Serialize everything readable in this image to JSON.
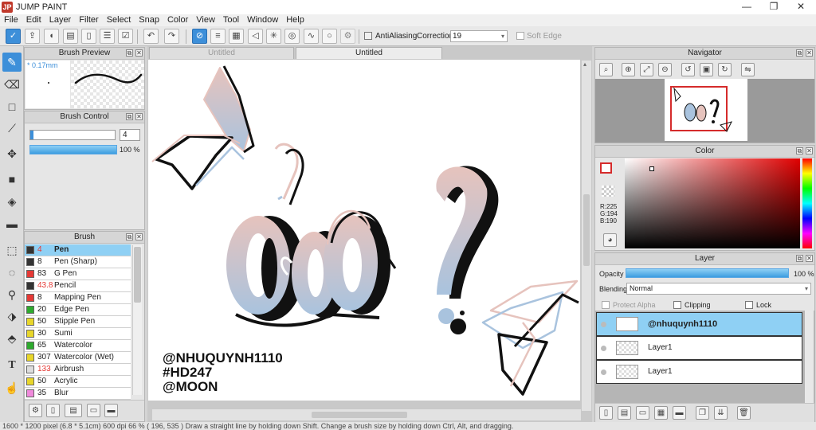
{
  "app": {
    "title": "JUMP PAINT",
    "logo": "JP"
  },
  "window_controls": {
    "minimize": "—",
    "maximize": "❐",
    "close": "✕"
  },
  "menu": [
    "File",
    "Edit",
    "Layer",
    "Filter",
    "Select",
    "Snap",
    "Color",
    "View",
    "Tool",
    "Window",
    "Help"
  ],
  "toolbar": {
    "antialiasing_label": "AntiAliasing",
    "correction_label": "Correction",
    "correction_value": "19",
    "soft_edge_label": "Soft Edge"
  },
  "brush_preview": {
    "title": "Brush Preview",
    "size_label": "* 0.17mm"
  },
  "brush_control": {
    "title": "Brush Control",
    "size_value": "4",
    "opacity_value": "100 %"
  },
  "brush_panel": {
    "title": "Brush",
    "items": [
      {
        "size": "4",
        "name": "Pen",
        "color": "#333333",
        "size_color": "#e53935",
        "selected": true
      },
      {
        "size": "8",
        "name": "Pen (Sharp)",
        "color": "#333333",
        "size_color": "#222222"
      },
      {
        "size": "83",
        "name": "G Pen",
        "color": "#e53935",
        "size_color": "#222222"
      },
      {
        "size": "43.8",
        "name": "Pencil",
        "color": "#333333",
        "size_color": "#e53935"
      },
      {
        "size": "8",
        "name": "Mapping Pen",
        "color": "#e53935",
        "size_color": "#222222"
      },
      {
        "size": "20",
        "name": "Edge Pen",
        "color": "#2eaa2e",
        "size_color": "#222222"
      },
      {
        "size": "50",
        "name": "Stipple Pen",
        "color": "#e8d62a",
        "size_color": "#222222"
      },
      {
        "size": "30",
        "name": "Sumi",
        "color": "#e8d62a",
        "size_color": "#222222"
      },
      {
        "size": "65",
        "name": "Watercolor",
        "color": "#2eaa2e",
        "size_color": "#222222"
      },
      {
        "size": "307",
        "name": "Watercolor (Wet)",
        "color": "#e8d62a",
        "size_color": "#222222"
      },
      {
        "size": "133",
        "name": "Airbrush",
        "color": "#dddddd",
        "size_color": "#e53935"
      },
      {
        "size": "50",
        "name": "Acrylic",
        "color": "#e8d62a",
        "size_color": "#222222"
      },
      {
        "size": "35",
        "name": "Blur",
        "color": "#f08adc",
        "size_color": "#222222"
      }
    ]
  },
  "documents": {
    "tabs": [
      "Untitled",
      "Untitled"
    ],
    "active_tab": 1
  },
  "artwork": {
    "caption_lines": [
      "@NHUQUYNH1110",
      "#HD247",
      "@MOON"
    ]
  },
  "navigator": {
    "title": "Navigator"
  },
  "color_panel": {
    "title": "Color",
    "r_label": "R:225",
    "g_label": "G:194",
    "b_label": "B:190",
    "current_color": "#e1c2be"
  },
  "layer_panel": {
    "title": "Layer",
    "opacity_label": "Opacity",
    "opacity_value": "100 %",
    "blending_label": "Blending",
    "blending_value": "Normal",
    "protect_alpha_label": "Protect Alpha",
    "clipping_label": "Clipping",
    "lock_label": "Lock",
    "layers": [
      {
        "name": "@nhuquynh1110",
        "selected": true
      },
      {
        "name": "Layer1"
      },
      {
        "name": "Layer1"
      }
    ]
  },
  "status_bar": {
    "text": "1600 * 1200 pixel   (6.8 * 5.1cm)   600 dpi   66 %   ( 196, 535 )   Draw a straight line by holding down Shift. Change a brush size by holding down Ctrl, Alt, and dragging."
  }
}
